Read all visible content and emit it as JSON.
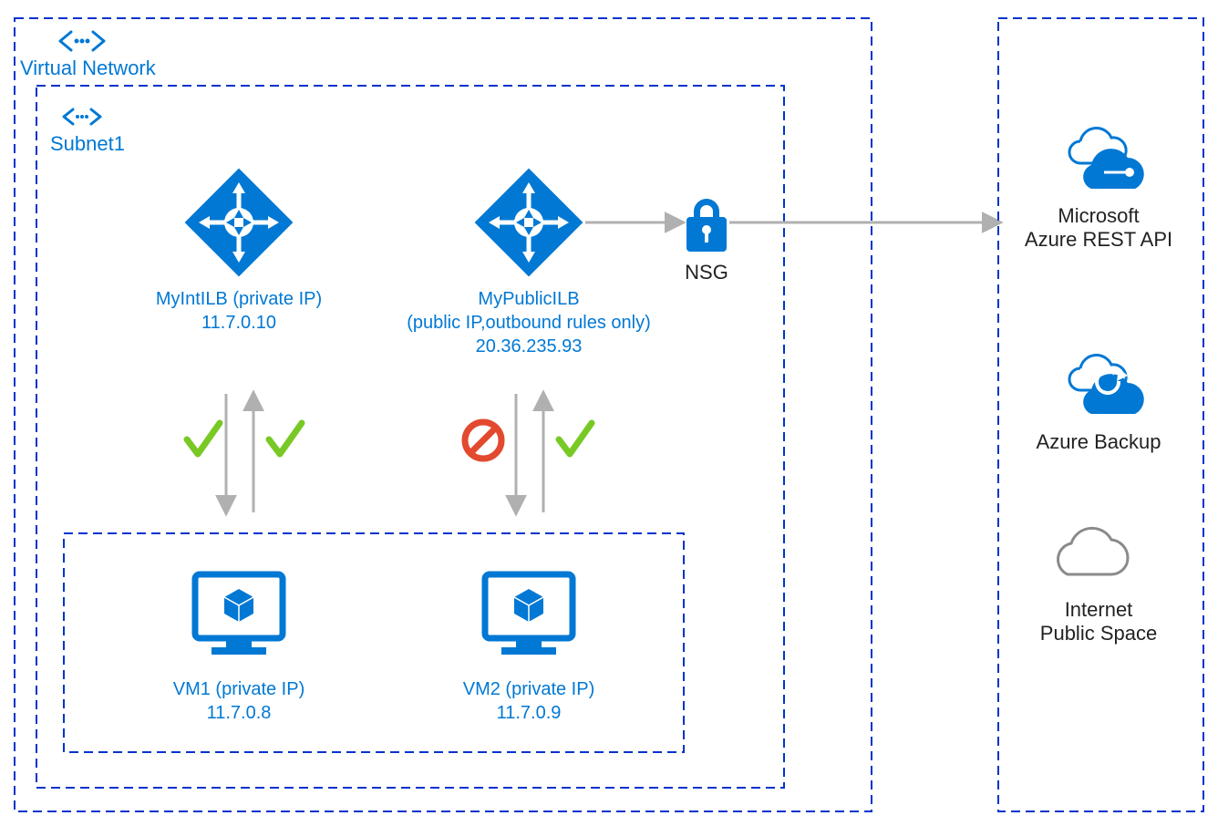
{
  "vnet": {
    "label": "Virtual Network"
  },
  "subnet": {
    "label": "Subnet1"
  },
  "int_ilb": {
    "name": "MyIntILB (private IP)",
    "ip": "11.7.0.10"
  },
  "pub_ilb": {
    "name": "MyPublicILB",
    "desc": "(public IP,outbound rules only)",
    "ip": "20.36.235.93"
  },
  "nsg": {
    "label": "NSG"
  },
  "vm1": {
    "name": "VM1 (private IP)",
    "ip": "11.7.0.8"
  },
  "vm2": {
    "name": "VM2 (private IP)",
    "ip": "11.7.0.9"
  },
  "cloud_api": {
    "line1": "Microsoft",
    "line2": "Azure REST API"
  },
  "cloud_backup": {
    "line1": "Azure Backup"
  },
  "cloud_internet": {
    "line1": "Internet",
    "line2": "Public Space"
  },
  "traffic": {
    "int_ilb_down": "allowed",
    "int_ilb_up": "allowed",
    "pub_ilb_down": "blocked",
    "pub_ilb_up": "allowed"
  }
}
